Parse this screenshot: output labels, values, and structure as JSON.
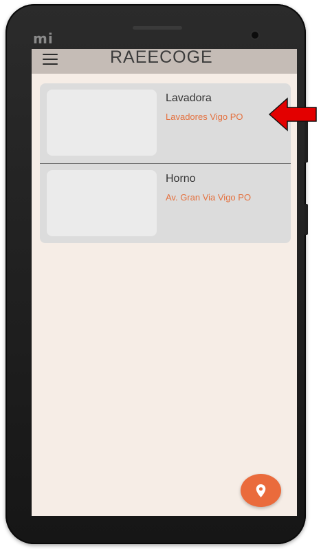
{
  "device": {
    "brand_logo": "mi"
  },
  "app_bar": {
    "title": "RAEECOGE",
    "menu_icon": "hamburger-menu-icon"
  },
  "list": {
    "items": [
      {
        "title": "Lavadora",
        "subtitle": "Lavadores Vigo PO"
      },
      {
        "title": "Horno",
        "subtitle": "Av. Gran Via Vigo PO"
      }
    ]
  },
  "fab": {
    "icon": "location-pin-icon"
  },
  "annotation": {
    "icon": "arrow-left-icon",
    "color": "#e30000"
  },
  "colors": {
    "accent": "#ea6b3c",
    "subtitle": "#e4713f",
    "app_bar": "#c5bcb6",
    "background": "#f6ede6",
    "card": "#dcdcdc"
  }
}
